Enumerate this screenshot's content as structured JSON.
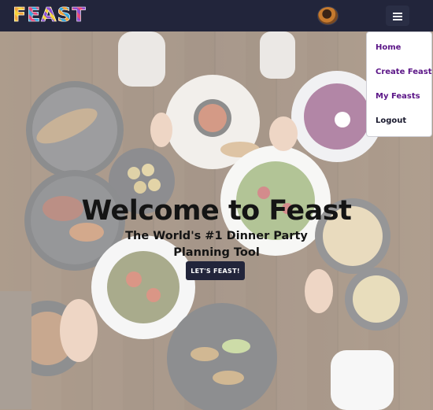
{
  "navbar": {
    "logo_text": "FEAST",
    "logo_colors": [
      "#f2a33a",
      "#e8487a",
      "#f5d33b",
      "#35a9e0",
      "#8e4fd1"
    ],
    "background": "#22253b",
    "avatar_icon": "user-avatar",
    "menu_icon": "hamburger-menu"
  },
  "menu": {
    "items": [
      {
        "label": "Home",
        "color": "#5b1587"
      },
      {
        "label": "Create Feast",
        "color": "#5b1587"
      },
      {
        "label": "My Feasts",
        "color": "#5b1587"
      },
      {
        "label": "Logout",
        "color": "#1a1a2e"
      }
    ]
  },
  "hero": {
    "title": "Welcome to Feast",
    "subtitle": "The World's #1 Dinner Party Planning Tool",
    "cta_label": "LET'S FEAST!"
  }
}
